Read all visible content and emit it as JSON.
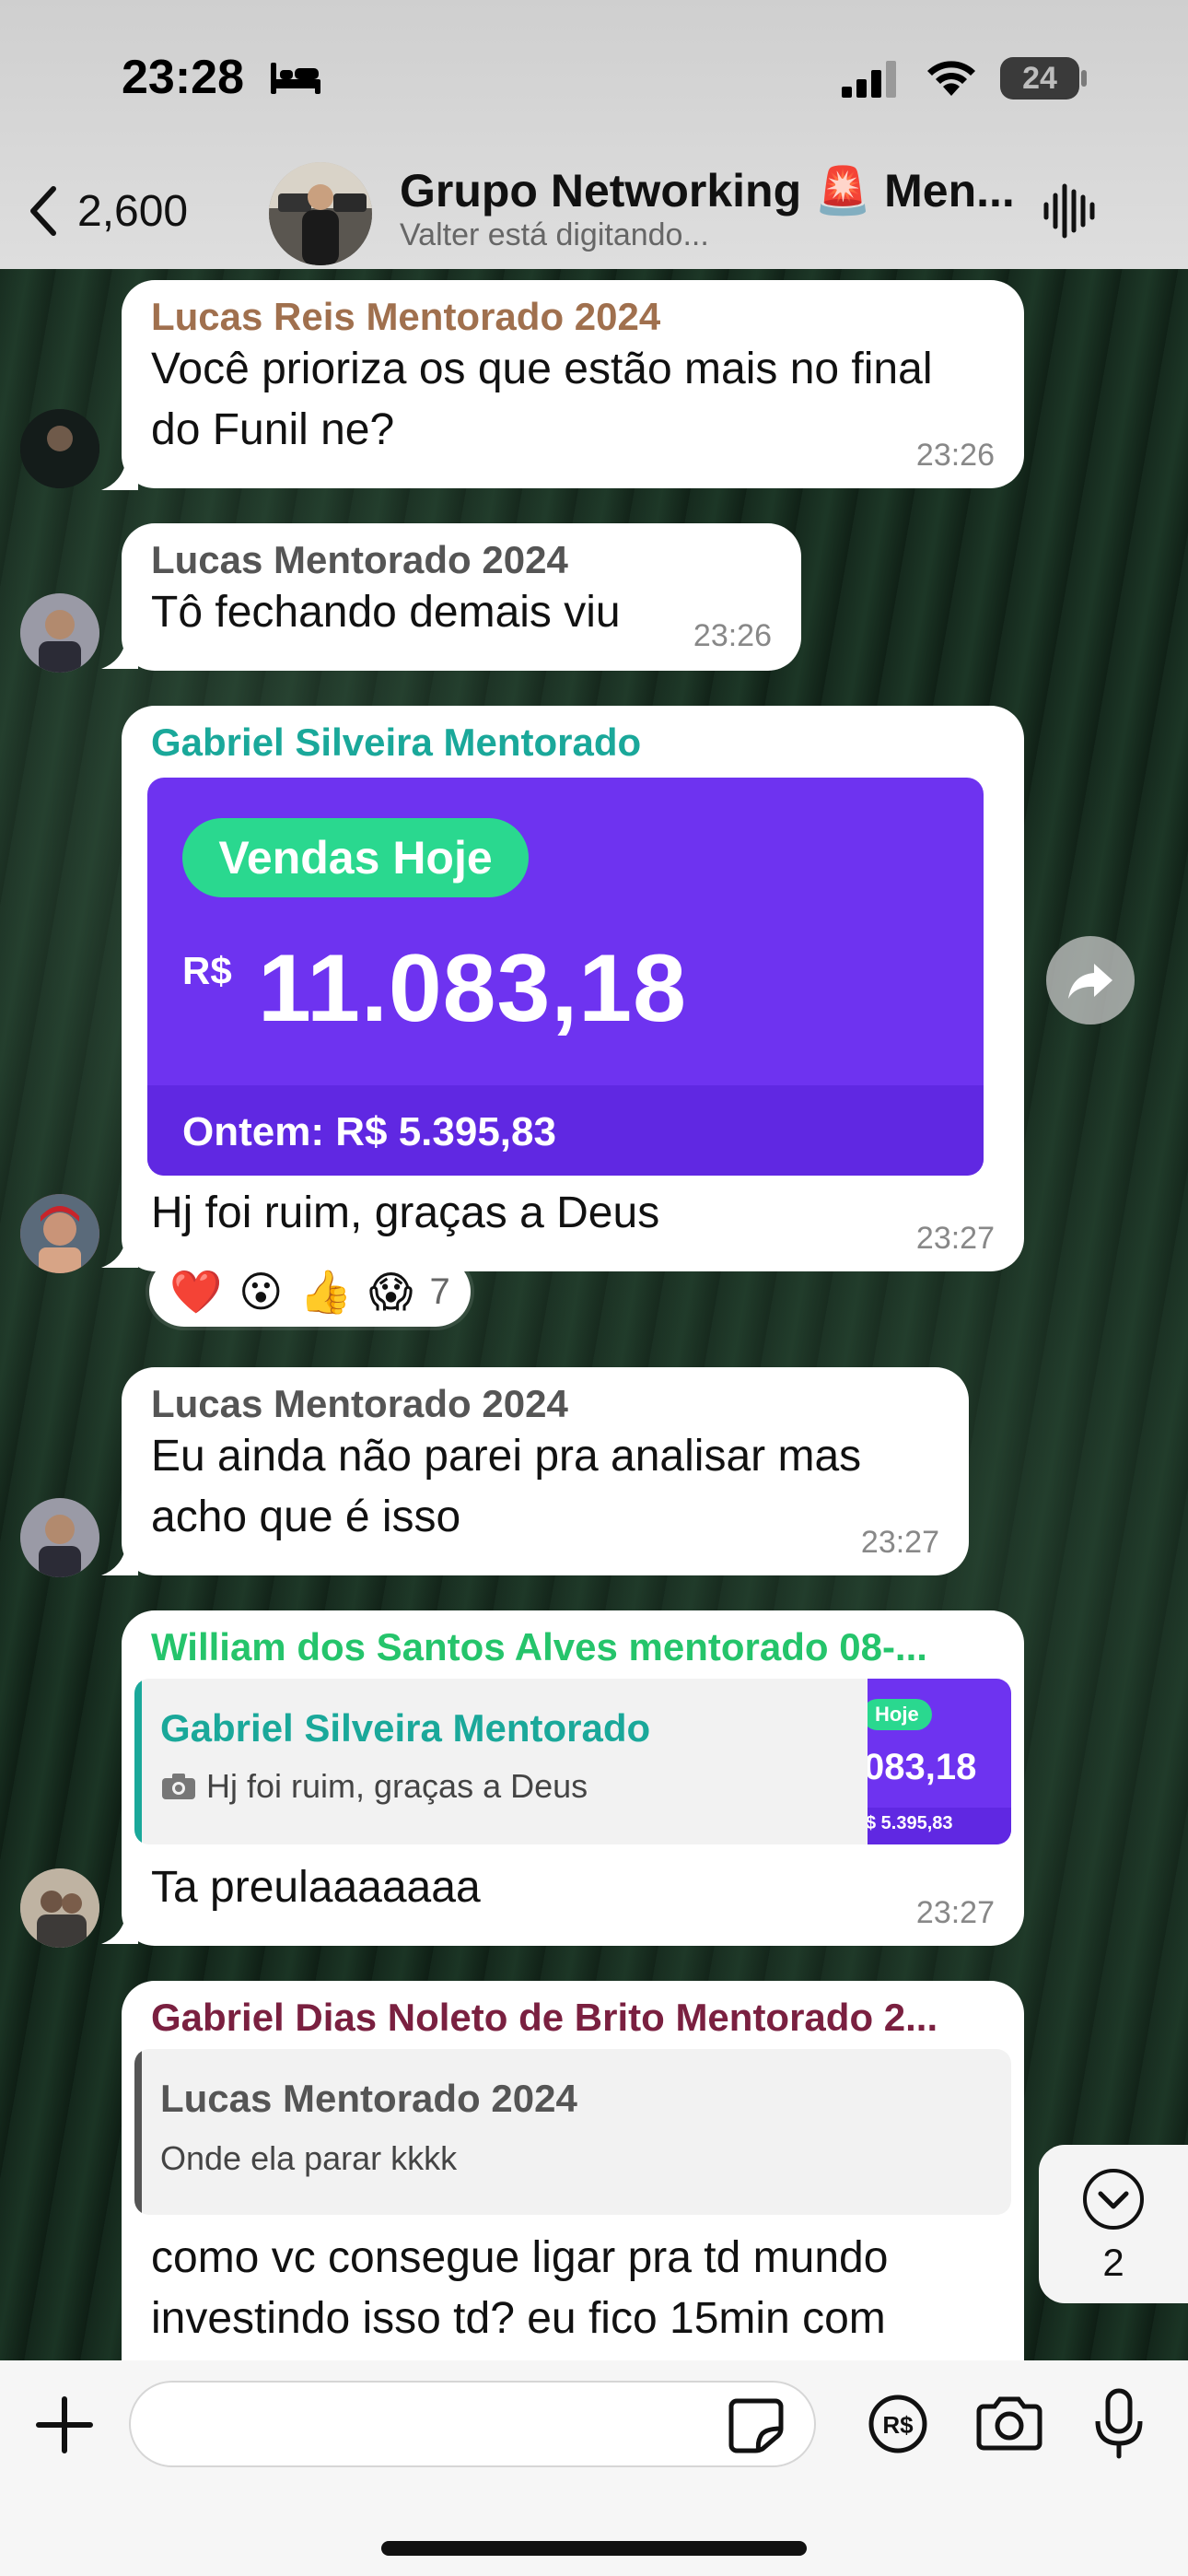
{
  "status_bar": {
    "time": "23:28",
    "battery": "24"
  },
  "header": {
    "back_count": "2,600",
    "title": "Grupo Networking 🚨 Men...",
    "subtitle": "Valter está digitando..."
  },
  "messages": [
    {
      "sender": "Lucas Reis Mentorado 2024",
      "sender_color": "#a0704e",
      "text_line1": "Você prioriza os que estão mais no final",
      "text_line2": "do Funil ne?",
      "time": "23:26"
    },
    {
      "sender": "Lucas Mentorado 2024",
      "sender_color": "#555555",
      "text": "Tô fechando demais viu",
      "time": "23:26"
    },
    {
      "sender": "Gabriel Silveira Mentorado",
      "sender_color": "#1aa89a",
      "card": {
        "badge": "Vendas Hoje",
        "currency": "R$",
        "amount": "11.083,18",
        "yesterday": "Ontem: R$ 5.395,83"
      },
      "text": "Hj foi ruim, graças a Deus",
      "time": "23:27",
      "reactions": [
        "❤️",
        "😮",
        "👍",
        "😱"
      ],
      "reaction_count": "7"
    },
    {
      "sender": "Lucas Mentorado 2024",
      "sender_color": "#555555",
      "text_line1": "Eu ainda não parei pra analisar mas",
      "text_line2": "acho que é isso",
      "time": "23:27"
    },
    {
      "sender": "William dos Santos Alves mentorado 08-...",
      "sender_color": "#25c46b",
      "quote": {
        "sender": "Gabriel Silveira Mentorado",
        "sender_color": "#1aa89a",
        "text": "Hj foi ruim, graças a Deus",
        "thumb_badge": "Hoje",
        "thumb_amount": "083,18",
        "thumb_small": "$ 5.395,83"
      },
      "text": "Ta preulaaaaaaa",
      "time": "23:27"
    },
    {
      "sender": "Gabriel Dias Noleto de Brito Mentorado 2...",
      "sender_color": "#7a2040",
      "quote": {
        "sender": "Lucas Mentorado 2024",
        "sender_color": "#555555",
        "text": "Onde ela parar kkkk"
      },
      "text_line1": "como vc consegue ligar pra td mundo",
      "text_line2": "investindo isso td? eu fico 15min com"
    }
  ],
  "scroll_down": {
    "count": "2"
  },
  "input": {
    "placeholder": ""
  },
  "icons": {
    "forward": "forward-icon",
    "scroll_down": "chevron-down-icon",
    "plus": "plus-icon",
    "sticker": "sticker-icon",
    "payment": "payment-icon",
    "camera": "camera-icon",
    "mic": "microphone-icon"
  }
}
